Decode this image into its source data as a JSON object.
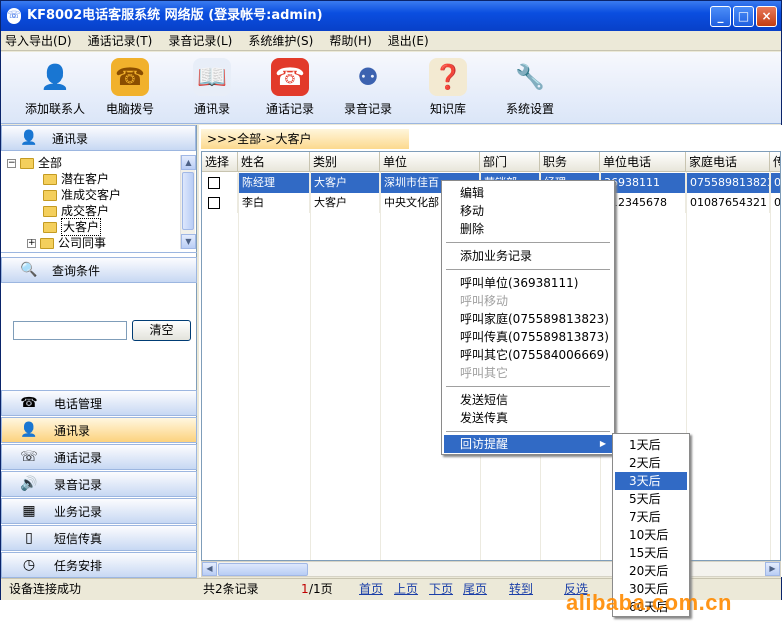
{
  "window": {
    "title": "KF8002电话客服系统 网络版 (登录帐号:admin)",
    "buttons": {
      "min": "_",
      "max": "□",
      "close": "×"
    }
  },
  "menu": [
    "导入导出(D)",
    "通话记录(T)",
    "录音记录(L)",
    "系统维护(S)",
    "帮助(H)",
    "退出(E)"
  ],
  "toolbar": [
    {
      "label": "添加联系人",
      "icon": "add-contact-icon"
    },
    {
      "label": "电脑拨号",
      "icon": "telephone-icon"
    },
    {
      "label": "通讯录",
      "icon": "address-book-icon"
    },
    {
      "label": "通话记录",
      "icon": "call-log-icon"
    },
    {
      "label": "录音记录",
      "icon": "recording-icon"
    },
    {
      "label": "知识库",
      "icon": "knowledge-icon"
    },
    {
      "label": "系统设置",
      "icon": "settings-icon"
    }
  ],
  "left": {
    "header": "通讯录",
    "tree": [
      {
        "label": "全部",
        "expander": "−"
      },
      {
        "label": "潜在客户"
      },
      {
        "label": "准成交客户"
      },
      {
        "label": "成交客户"
      },
      {
        "label": "大客户"
      },
      {
        "label": "公司同事",
        "expander": "+"
      }
    ],
    "query_header": "查询条件",
    "search_value": "",
    "clear_label": "清空",
    "nav": [
      "电话管理",
      "通讯录",
      "通话记录",
      "录音记录",
      "业务记录",
      "短信传真",
      "任务安排"
    ]
  },
  "main": {
    "breadcrumb": ">>>全部->大客户",
    "columns": [
      "选择",
      "姓名",
      "类别",
      "单位",
      "部门",
      "职务",
      "单位电话",
      "家庭电话",
      "传"
    ],
    "rows": [
      {
        "name": "陈经理",
        "category": "大客户",
        "company": "深圳市佳百",
        "dept": "营销部",
        "title": "经理",
        "work_phone": "36938111",
        "home_phone": "075589813823",
        "fax": "0"
      },
      {
        "name": "李白",
        "category": "大客户",
        "company": "中央文化部",
        "dept": "",
        "title": "",
        "work_phone": "012345678",
        "home_phone": "01087654321",
        "fax": "0"
      }
    ]
  },
  "context_menu": [
    {
      "label": "编辑"
    },
    {
      "label": "移动"
    },
    {
      "label": "删除"
    },
    {
      "label": "添加业务记录"
    },
    {
      "label": "呼叫单位(36938111)"
    },
    {
      "label": "呼叫移动",
      "disabled": true
    },
    {
      "label": "呼叫家庭(075589813823)"
    },
    {
      "label": "呼叫传真(075589813873)"
    },
    {
      "label": "呼叫其它(075584006669)"
    },
    {
      "label": "呼叫其它",
      "disabled": true
    },
    {
      "label": "发送短信"
    },
    {
      "label": "发送传真"
    },
    {
      "label": "回访提醒",
      "submenu": true
    }
  ],
  "submenu": [
    "1天后",
    "2天后",
    "3天后",
    "5天后",
    "7天后",
    "10天后",
    "15天后",
    "20天后",
    "30天后",
    "60天后"
  ],
  "status": {
    "left": "设备连接成功",
    "record_count": "共2条记录",
    "page_current": "1",
    "page_total": "/1页",
    "first": "首页",
    "prev": "上页",
    "next": "下页",
    "last": "尾页",
    "goto": "转到",
    "invert": "反选"
  },
  "watermark": "alibaba.com.cn",
  "colors": {
    "selection": "#316ac5",
    "titlebar": "#0a4ee0",
    "breadcrumb": "#fcd98e"
  }
}
